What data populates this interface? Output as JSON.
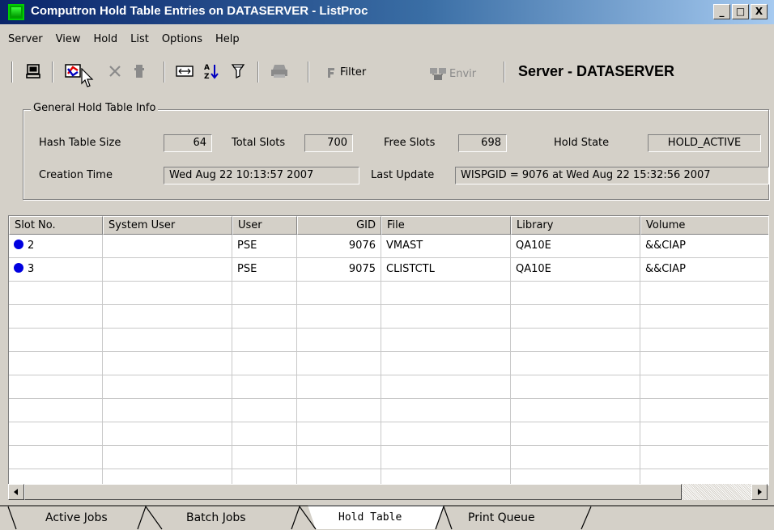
{
  "window": {
    "title": "Computron Hold Table Entries on DATASERVER - ListProc",
    "controls": {
      "minimize": "_",
      "maximize": "□",
      "close": "X"
    }
  },
  "menu": [
    "Server",
    "View",
    "Hold",
    "List",
    "Options",
    "Help"
  ],
  "toolbar": {
    "filter_label": "Filter",
    "environ_label": "Envir",
    "server_label": "Server - DATASERVER"
  },
  "info": {
    "group_title": "General Hold Table Info",
    "hash_table_size_label": "Hash Table Size",
    "hash_table_size": "64",
    "total_slots_label": "Total Slots",
    "total_slots": "700",
    "free_slots_label": "Free Slots",
    "free_slots": "698",
    "hold_state_label": "Hold State",
    "hold_state": "HOLD_ACTIVE",
    "creation_time_label": "Creation Time",
    "creation_time": "Wed Aug 22 10:13:57 2007",
    "last_update_label": "Last Update",
    "last_update": "WISPGID = 9076 at Wed Aug 22 15:32:56 2007"
  },
  "table": {
    "columns": [
      "Slot No.",
      "System User",
      "User",
      "GID",
      "File",
      "Library",
      "Volume"
    ],
    "rows": [
      {
        "slot": "2",
        "system_user": "",
        "user": "PSE",
        "gid": "9076",
        "file": "VMAST",
        "library": "QA10E",
        "volume": "&&CIAP"
      },
      {
        "slot": "3",
        "system_user": "",
        "user": "PSE",
        "gid": "9075",
        "file": "CLISTCTL",
        "library": "QA10E",
        "volume": "&&CIAP"
      }
    ]
  },
  "tabs": [
    "Active Jobs",
    "Batch Jobs",
    "Hold Table",
    "Print Queue"
  ],
  "active_tab": "Hold Table",
  "colors": {
    "titlebar": "#0a246a",
    "face": "#d4d0c8",
    "status_dot": "#0000e0"
  }
}
